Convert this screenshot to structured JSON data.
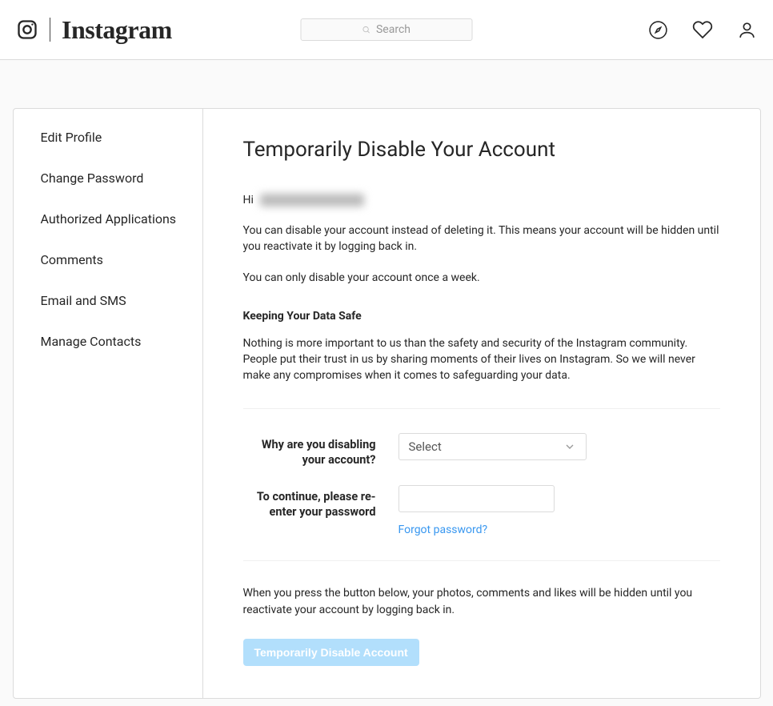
{
  "brand": "Instagram",
  "search": {
    "placeholder": "Search"
  },
  "sidebar": {
    "items": [
      {
        "label": "Edit Profile"
      },
      {
        "label": "Change Password"
      },
      {
        "label": "Authorized Applications"
      },
      {
        "label": "Comments"
      },
      {
        "label": "Email and SMS"
      },
      {
        "label": "Manage Contacts"
      }
    ]
  },
  "main": {
    "title": "Temporarily Disable Your Account",
    "greeting_prefix": "Hi",
    "username_redacted": true,
    "para1": "You can disable your account instead of deleting it. This means your account will be hidden until you reactivate it by logging back in.",
    "para2": "You can only disable your account once a week.",
    "safe_heading": "Keeping Your Data Safe",
    "safe_para": "Nothing is more important to us than the safety and security of the Instagram community. People put their trust in us by sharing moments of their lives on Instagram. So we will never make any compromises when it comes to safeguarding your data.",
    "reason_label": "Why are you disabling your account?",
    "reason_select_placeholder": "Select",
    "password_label": "To continue, please re-enter your password",
    "forgot_link": "Forgot password?",
    "confirm_para": "When you press the button below, your photos, comments and likes will be hidden until you reactivate your account by logging back in.",
    "disable_button": "Temporarily Disable Account"
  }
}
